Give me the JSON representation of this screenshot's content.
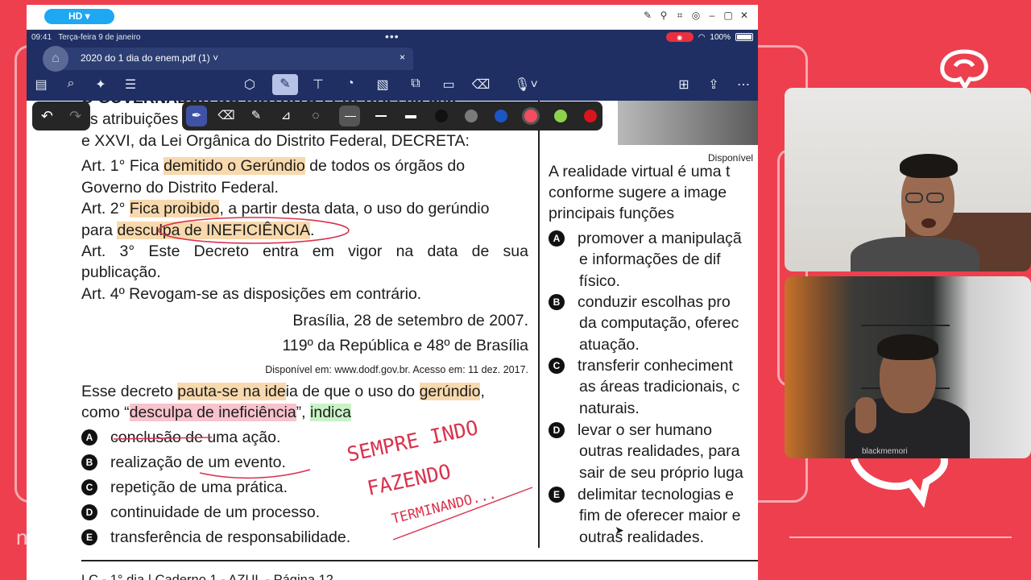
{
  "window": {
    "hd_badge": "HD ▾",
    "time": "09:41",
    "date": "Terça-feira 9 de janeiro",
    "battery": "100%",
    "tab_title": "2020 do 1 dia do enem.pdf (1)",
    "tab_chevron": "˅",
    "tab_close": "×"
  },
  "icons": {
    "window_controls": [
      "pencil-icon",
      "pin-icon",
      "crop-icon",
      "target-icon",
      "minimize-icon",
      "restore-icon",
      "close-icon"
    ],
    "toolbar_left": [
      "sidebar-icon",
      "search-icon",
      "sparkle-icon",
      "list-icon"
    ],
    "toolbar_center": [
      "shapes-icon",
      "pen-annotate-icon",
      "text-box-icon",
      "sticker-icon",
      "image-icon",
      "elements-icon",
      "note-icon",
      "eraser-tools-icon",
      "voice-icon"
    ],
    "toolbar_right": [
      "add-page-icon",
      "share-icon",
      "more-icon"
    ]
  },
  "pen_toolbar": {
    "undo": "↶",
    "redo": "↷",
    "colors": [
      "#111111",
      "#7a7a7a",
      "#1a56c4",
      "#f24d60",
      "#8bd44a",
      "#d9141c"
    ]
  },
  "document": {
    "header_partial": "O GOVERNADOR DO DISTRITO FEDERAL, no uso",
    "line_attrib": "as atribuições",
    "line_xxvi": "e XXVI, da Lei Orgânica do Distrito Federal, DECRETA:",
    "art1_a": "Art. 1° Fica ",
    "art1_hl": "demitido o Gerúndio",
    "art1_b": " de todos os órgãos do",
    "art1_c": "Governo do Distrito Federal.",
    "art2_a": "Art. 2° ",
    "art2_hl": "Fica proibido",
    "art2_b": ", a partir desta data, o uso do gerúndio",
    "art2_c": "para ",
    "art2_hl2": "desculpa de INEFICIÊNCIA",
    "art2_d": ".",
    "art3_a": "Art. 3° Este Decreto entra em vigor na data de sua",
    "art3_b": "publicação.",
    "art4": "Art. 4º Revogam-se as disposições em contrário.",
    "place_date": "Brasília, 28 de setembro de 2007.",
    "republic": "119º da República e 48º de Brasília",
    "source": "Disponível em: www.dodf.gov.br. Acesso em: 11 dez. 2017.",
    "q_a": "Esse decreto ",
    "q_hl1": "pauta-se na ide",
    "q_b": "ia de que o uso do ",
    "q_hl2": "gerúndio",
    "q_c": ",",
    "q_d": "como “",
    "q_hl3": "desculpa de ineficiência",
    "q_e": "”, ",
    "q_hl4": "indica",
    "options": [
      {
        "letter": "A",
        "text": "conclusão de uma ação."
      },
      {
        "letter": "B",
        "text": "realização de um evento."
      },
      {
        "letter": "C",
        "text": "repetição de uma prática."
      },
      {
        "letter": "D",
        "text": "continuidade de um processo."
      },
      {
        "letter": "E",
        "text": "transferência de responsabilidade."
      }
    ],
    "footer": "LC - 1° dia | Caderno 1 - AZUL - Página 12",
    "handwriting": [
      "SEMPRE INDO",
      "FAZENDO",
      "TERMINANDO..."
    ]
  },
  "right_column": {
    "caption": "Disponível",
    "stem": [
      "A realidade virtual é uma t",
      "conforme sugere a image",
      "principais funções"
    ],
    "options": [
      {
        "letter": "A",
        "lines": [
          "promover a manipulaçã",
          "e informações de dif",
          "físico."
        ]
      },
      {
        "letter": "B",
        "lines": [
          "conduzir escolhas pro",
          "da computação, oferec",
          "atuação."
        ]
      },
      {
        "letter": "C",
        "lines": [
          "transferir conheciment",
          "as áreas tradicionais, c",
          "naturais."
        ]
      },
      {
        "letter": "D",
        "lines": [
          "levar o ser humano",
          "outras realidades, para",
          "sair de seu próprio luga"
        ]
      },
      {
        "letter": "E",
        "lines": [
          "delimitar tecnologias e",
          "fim de oferecer maior e",
          "outras realidades."
        ]
      }
    ]
  },
  "webcam": {
    "shirt_text": "blackmemori"
  }
}
